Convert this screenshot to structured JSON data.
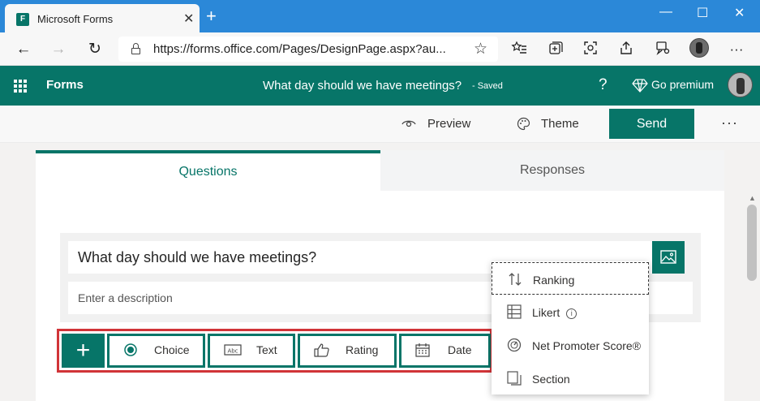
{
  "browser": {
    "tab_title": "Microsoft Forms",
    "favicon_letter": "F",
    "close_glyph": "✕",
    "newtab_glyph": "+",
    "window_controls": {
      "minimize": "—",
      "maximize": "☐",
      "close": "✕"
    },
    "url": "https://forms.office.com/Pages/DesignPage.aspx?au...",
    "nav": {
      "back": "←",
      "forward": "→",
      "refresh": "↻"
    },
    "star_glyph": "☆",
    "toolbar_icons": [
      "favorites-icon",
      "collections-icon",
      "screenshot-icon",
      "share-icon",
      "feedback-icon",
      "profile-avatar",
      "more-icon"
    ],
    "more_glyph": "···"
  },
  "app": {
    "name": "Forms",
    "form_title": "What day should we have meetings?",
    "saved_status": "- Saved",
    "help_glyph": "?",
    "premium_label": "Go premium",
    "accent_color": "#077568"
  },
  "commands": {
    "preview": "Preview",
    "theme": "Theme",
    "send": "Send",
    "more": "···"
  },
  "tabs": {
    "questions": "Questions",
    "responses": "Responses",
    "active": "Questions"
  },
  "question": {
    "title": "What day should we have meetings?",
    "description_placeholder": "Enter a description"
  },
  "add_bar": {
    "plus": "+",
    "options": [
      {
        "label": "Choice",
        "icon": "radio-icon"
      },
      {
        "label": "Text",
        "icon": "text-abc-icon"
      },
      {
        "label": "Rating",
        "icon": "thumbs-up-icon"
      },
      {
        "label": "Date",
        "icon": "calendar-icon"
      }
    ],
    "highlight_color": "#d13438"
  },
  "menu": {
    "items": [
      {
        "label": "Ranking",
        "icon": "ranking-icon",
        "selected": true
      },
      {
        "label": "Likert",
        "icon": "likert-grid-icon",
        "info": "i"
      },
      {
        "label": "Net Promoter Score®",
        "icon": "gauge-icon"
      },
      {
        "label": "Section",
        "icon": "section-icon"
      }
    ]
  }
}
